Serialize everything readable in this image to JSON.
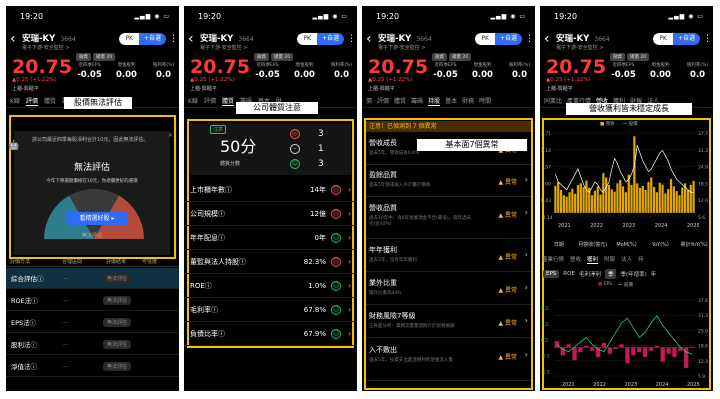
{
  "common": {
    "time": "19:20",
    "stock_name": "安瑞-KY",
    "stock_code": "3664",
    "sub": "電子下游-安全監控 >",
    "pk": "PK",
    "fav": "+自選",
    "price": "20.75",
    "change": "▲0.25 (+1.22%)",
    "market": "上櫃-興櫃平",
    "tag1": "融資",
    "tag2": "總量 20",
    "eps_labels": [
      "近四季EPS",
      "現金股利",
      "殖利率(%)"
    ],
    "eps_values": [
      "-0.05",
      "0.00",
      "0.0"
    ]
  },
  "panel1": {
    "tabs": [
      "K線",
      "評價",
      "體質",
      "籌碼",
      "基本",
      "財務"
    ],
    "banner": "股價無法評估",
    "note": "該公司最近四季每股淨利合計10元，因此無法評估。",
    "big_text": "無法評估",
    "gauge_msg": "今年下降揚期價格在10元，你適價更好的選擇",
    "button": "看精選好股 ▸",
    "gauge_caption": "無法評估",
    "table_header": [
      "評價方法",
      "合理區間",
      "評價結果",
      "可信度"
    ],
    "rows": [
      {
        "label": "綜合評估ⓘ",
        "range": "--",
        "result": "無法評估"
      },
      {
        "label": "ROE法ⓘ",
        "range": "--",
        "result": "無法評估"
      },
      {
        "label": "EPS法ⓘ",
        "range": "--",
        "result": "無法評估"
      },
      {
        "label": "股利法ⓘ",
        "range": "--",
        "result": "無法評估"
      },
      {
        "label": "淨值法ⓘ",
        "range": "--",
        "result": "無法評估"
      }
    ]
  },
  "panel2": {
    "tabs": [
      "K線",
      "評價",
      "體質",
      "籌碼",
      "基本",
      "財"
    ],
    "banner": "公司體質注意",
    "stag": "注意",
    "score": "50分",
    "score_label": "體質分數",
    "counts": [
      "3",
      "1",
      "3"
    ],
    "rows": [
      {
        "label": "上市櫃年數ⓘ",
        "value": "14年",
        "status": "bad"
      },
      {
        "label": "公司規模ⓘ",
        "value": "12億",
        "status": "bad"
      },
      {
        "label": "年年配息ⓘ",
        "value": "0年",
        "status": "good"
      },
      {
        "label": "董監與法人持股ⓘ",
        "value": "82.3%",
        "status": "bad"
      },
      {
        "label": "ROEⓘ",
        "value": "1.0%",
        "status": "good"
      },
      {
        "label": "毛利率ⓘ",
        "value": "67.8%",
        "status": "good"
      },
      {
        "label": "負債比率ⓘ",
        "value": "67.9%",
        "status": "good"
      }
    ]
  },
  "panel3": {
    "tabs": [
      "價",
      "評價",
      "體質",
      "籌碼",
      "持股",
      "基本",
      "財務",
      "時間",
      "封包"
    ],
    "banner": "基本面7個異常",
    "alert": "注意！已偵測到 7 個異常",
    "warn": "異常",
    "rows": [
      {
        "title": "營收成長",
        "desc": "過去5年，營收成長0.6%"
      },
      {
        "title": "盈餘品質",
        "desc": "過去5年營運與入外計畫計暴跌"
      },
      {
        "title": "營收品質",
        "desc": "過去10年中，有6年營業現金不佳(最低)，兩年過去元(近40%)"
      },
      {
        "title": "年年獲利",
        "desc": "過去5年，沒有年年獲利"
      },
      {
        "title": "業外比重",
        "desc": "業外比重為44%"
      },
      {
        "title": "財務風險7等級",
        "desc": "正負面分析：業務流量量週期介於財務風險"
      },
      {
        "title": "入不敷出",
        "desc": "過去5年，投資支出超過營利的現金流入量"
      }
    ]
  },
  "panel4": {
    "tabs": [
      "同業比",
      "產業行情",
      "營收",
      "獲利",
      "財報",
      "法人"
    ],
    "banner": "營收獲利皆未穩定成長",
    "legend": [
      "營收",
      "股價"
    ],
    "chart1": {
      "years": [
        "2021",
        "2022",
        "2023",
        "2024",
        "2025"
      ],
      "y_left": [
        "2.71",
        "2.14",
        "1.57",
        "1.00",
        "0.43",
        "-0.14"
      ],
      "y_right": [
        "37.7",
        "31.3",
        "24.9",
        "18.5",
        "12.0",
        "5.6"
      ],
      "revenue": [
        0.92,
        1.05,
        0.78,
        0.6,
        0.55,
        0.7,
        0.82,
        0.65,
        0.95,
        1.0,
        0.88,
        1.1,
        0.85,
        0.6,
        0.75,
        0.9,
        0.62,
        1.35,
        1.2,
        0.95,
        0.8,
        0.72,
        1.0,
        1.12,
        0.9,
        0.7,
        1.3,
        0.95,
        2.6,
        1.0,
        0.85,
        0.92,
        0.78,
        1.05,
        1.2,
        0.88,
        0.7,
        1.02,
        0.96,
        0.66,
        0.81,
        1.15,
        0.9,
        0.74,
        0.6,
        0.86,
        1.0,
        0.78,
        0.95,
        1.08
      ],
      "price": [
        22,
        19,
        18,
        17,
        16,
        18,
        20,
        22,
        24,
        21,
        18,
        16,
        15,
        17,
        19,
        18,
        16,
        15,
        17,
        19,
        24,
        28,
        26,
        23,
        21,
        19,
        20,
        22,
        25,
        33,
        30,
        27,
        25,
        23,
        24,
        26,
        28,
        30,
        31,
        29,
        27,
        24,
        22,
        20,
        19,
        18,
        17,
        16,
        15,
        15
      ]
    },
    "table_headers": [
      "日期",
      "月營收(億元)",
      "MoM(%)",
      "YoY(%)",
      "累計YoY(%)"
    ],
    "tabs2": [
      "產業行情",
      "營收",
      "獲利",
      "財報",
      "法人",
      "持"
    ],
    "tabs3": [
      "EPS",
      "ROE",
      "毛利淨利",
      "季",
      "季(年增率)",
      "年"
    ],
    "legend2": [
      "EPS",
      "股價"
    ],
    "chart2": {
      "years": [
        "2021",
        "2022",
        "2023",
        "2024",
        "2025"
      ],
      "y_left": [
        "2.5",
        "1.5",
        "0.5",
        "-0.5",
        "-1.5"
      ],
      "y_right": [
        "37.6",
        "31.3",
        "25.0",
        "18.6",
        "12.3",
        "5.9"
      ],
      "eps": [
        0.4,
        -0.5,
        0.2,
        -0.8,
        -0.3,
        0.1,
        -0.2,
        -0.6,
        0.3,
        -0.4,
        -0.1,
        0.2,
        -1.0,
        -0.5,
        -0.3,
        -0.6,
        -0.2,
        0.1,
        -0.9,
        -0.4,
        -0.6,
        -0.2,
        -1.3,
        0.05
      ],
      "price": [
        19,
        17,
        16,
        18,
        20,
        22,
        19,
        17,
        16,
        20,
        24,
        28,
        30,
        26,
        22,
        24,
        28,
        31,
        27,
        24,
        21,
        18,
        16,
        15
      ]
    }
  }
}
